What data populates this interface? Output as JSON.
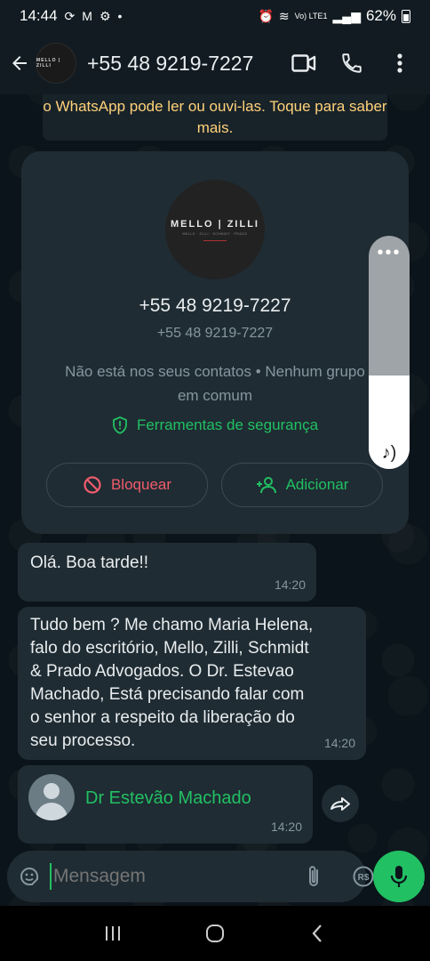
{
  "status_bar": {
    "time": "14:44",
    "battery": "62%",
    "network": "Vo) LTE1"
  },
  "header": {
    "contact_number": "+55 48 9219-7227",
    "avatar_logo_text": "MELLO | ZILLI"
  },
  "encryption_notice": {
    "text": "o WhatsApp pode ler ou ouvi-las. Toque para saber mais."
  },
  "contact_card": {
    "avatar_logo_main": "MELLO | ZILLI",
    "avatar_logo_sub": "MELLO · ZILLI · SCHMIDT · PRADO",
    "name": "+55 48 9219-7227",
    "number": "+55 48 9219-7227",
    "info": "Não está nos seus contatos • Nenhum grupo em comum",
    "security_link": "Ferramentas de segurança",
    "block_label": "Bloquear",
    "add_label": "Adicionar"
  },
  "volume": {
    "level": 0.4
  },
  "messages": [
    {
      "text": "Olá. Boa tarde!!",
      "time": "14:20"
    },
    {
      "text": "Tudo bem ? Me chamo Maria Helena, falo do escritório, Mello, Zilli, Schmidt & Prado Advogados. O Dr. Estevao Machado, Está precisando falar com o senhor a respeito da liberação do seu processo.",
      "time": "14:20"
    },
    {
      "contact_name": "Dr Estevão Machado",
      "time": "14:20"
    }
  ],
  "input": {
    "placeholder": "Mensagem"
  },
  "colors": {
    "accent": "#21c063",
    "danger": "#f15c6d",
    "notice": "#ffd279",
    "bubble": "#1f2c33",
    "background": "#0b141a"
  }
}
